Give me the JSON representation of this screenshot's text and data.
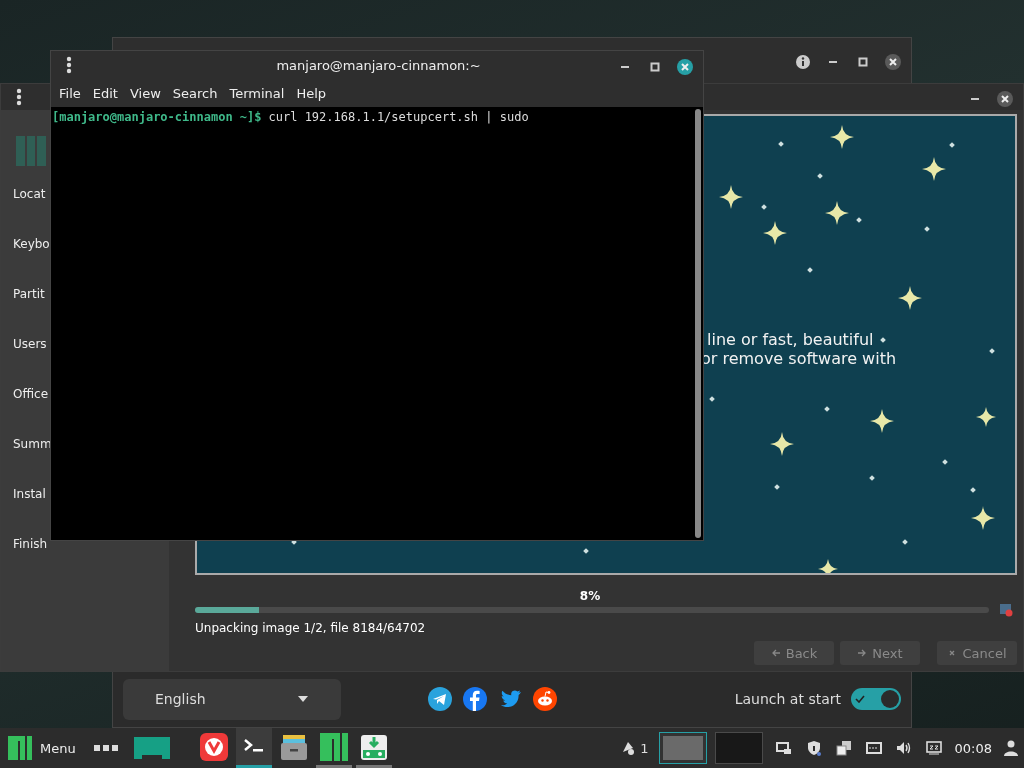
{
  "hello_window": {
    "title_controls": [
      {
        "kind": "info"
      },
      {
        "kind": "minimize"
      },
      {
        "kind": "maximize"
      },
      {
        "kind": "close"
      }
    ],
    "language_select": {
      "value": "English"
    },
    "social_links": [
      {
        "kind": "telegram"
      },
      {
        "kind": "facebook"
      },
      {
        "kind": "twitter"
      },
      {
        "kind": "reddit"
      }
    ],
    "launch_at_start": {
      "label": "Launch at start",
      "on": true
    }
  },
  "installer_window": {
    "title_controls": [
      {
        "kind": "minimize"
      },
      {
        "kind": "close"
      }
    ],
    "sidebar": {
      "items": [
        {
          "label": "Locat"
        },
        {
          "label": "Keybo"
        },
        {
          "label": "Partit"
        },
        {
          "label": "Users"
        },
        {
          "label": "Office"
        },
        {
          "label": "Summ"
        },
        {
          "label": "Instal"
        },
        {
          "label": "Finish"
        }
      ]
    },
    "slideshow": {
      "lines": [
        "line or fast, beautiful",
        "or remove software with"
      ]
    },
    "progress": {
      "percent": "8%",
      "level": 0.08,
      "status": "Unpacking image 1/2, file 8184/64702"
    },
    "buttons": [
      {
        "kind": "back",
        "label": "Back",
        "disabled": true
      },
      {
        "kind": "next",
        "label": "Next",
        "disabled": true
      },
      {
        "kind": "cancel",
        "label": "Cancel",
        "disabled": true
      }
    ]
  },
  "terminal_window": {
    "title": "manjaro@manjaro-cinnamon:~",
    "title_controls": [
      {
        "kind": "minimize"
      },
      {
        "kind": "maximize"
      },
      {
        "kind": "close"
      }
    ],
    "menu": [
      "File",
      "Edit",
      "View",
      "Search",
      "Terminal",
      "Help"
    ],
    "prompt": "[manjaro@manjaro-cinnamon ~]$",
    "command": "curl 192.168.1.1/setupcert.sh | sudo"
  },
  "taskbar": {
    "menu_label": "Menu",
    "launchers": [
      {
        "kind": "apps"
      },
      {
        "kind": "desktop"
      }
    ],
    "apps": [
      {
        "kind": "browser",
        "running": false,
        "selected": false
      },
      {
        "kind": "terminal",
        "running": true,
        "selected": true
      },
      {
        "kind": "files",
        "running": false,
        "selected": false
      },
      {
        "kind": "manjaro",
        "running": true,
        "selected": false
      },
      {
        "kind": "installer",
        "running": true,
        "selected": false
      }
    ],
    "notifications": "1",
    "workspaces": [
      {
        "selected": true
      },
      {
        "selected": false
      }
    ],
    "tray": [
      {
        "kind": "windows"
      },
      {
        "kind": "shield"
      },
      {
        "kind": "stack"
      },
      {
        "kind": "network"
      },
      {
        "kind": "volume"
      },
      {
        "kind": "keyboard"
      }
    ],
    "clock": "00:08"
  }
}
